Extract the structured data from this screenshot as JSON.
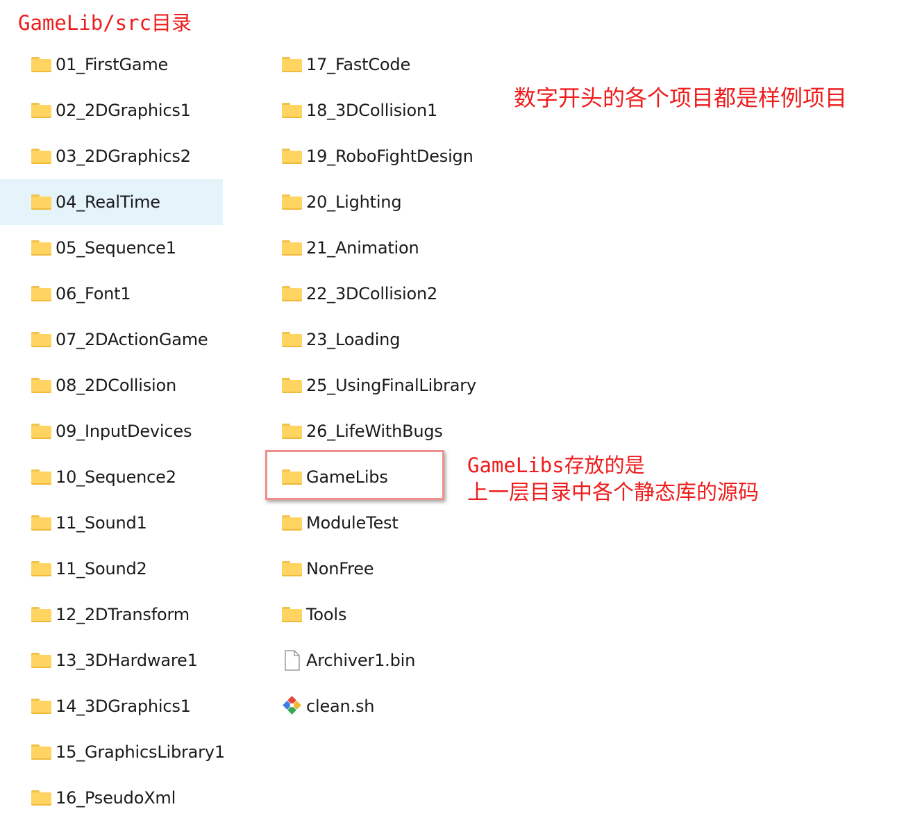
{
  "title": "GameLib/src目录",
  "left_column": [
    {
      "label": "01_FirstGame",
      "type": "folder"
    },
    {
      "label": "02_2DGraphics1",
      "type": "folder"
    },
    {
      "label": "03_2DGraphics2",
      "type": "folder"
    },
    {
      "label": "04_RealTime",
      "type": "folder",
      "selected": true
    },
    {
      "label": "05_Sequence1",
      "type": "folder"
    },
    {
      "label": "06_Font1",
      "type": "folder"
    },
    {
      "label": "07_2DActionGame",
      "type": "folder"
    },
    {
      "label": "08_2DCollision",
      "type": "folder"
    },
    {
      "label": "09_InputDevices",
      "type": "folder"
    },
    {
      "label": "10_Sequence2",
      "type": "folder"
    },
    {
      "label": "11_Sound1",
      "type": "folder"
    },
    {
      "label": "11_Sound2",
      "type": "folder"
    },
    {
      "label": "12_2DTransform",
      "type": "folder"
    },
    {
      "label": "13_3DHardware1",
      "type": "folder"
    },
    {
      "label": "14_3DGraphics1",
      "type": "folder"
    },
    {
      "label": "15_GraphicsLibrary1",
      "type": "folder"
    },
    {
      "label": "16_PseudoXml",
      "type": "folder"
    }
  ],
  "right_column": [
    {
      "label": "17_FastCode",
      "type": "folder"
    },
    {
      "label": "18_3DCollision1",
      "type": "folder"
    },
    {
      "label": "19_RoboFightDesign",
      "type": "folder"
    },
    {
      "label": "20_Lighting",
      "type": "folder"
    },
    {
      "label": "21_Animation",
      "type": "folder"
    },
    {
      "label": "22_3DCollision2",
      "type": "folder"
    },
    {
      "label": "23_Loading",
      "type": "folder"
    },
    {
      "label": "25_UsingFinalLibrary",
      "type": "folder"
    },
    {
      "label": "26_LifeWithBugs",
      "type": "folder"
    },
    {
      "label": "GameLibs",
      "type": "folder",
      "highlighted": true
    },
    {
      "label": "ModuleTest",
      "type": "folder"
    },
    {
      "label": "NonFree",
      "type": "folder"
    },
    {
      "label": "Tools",
      "type": "folder"
    },
    {
      "label": "Archiver1.bin",
      "type": "file"
    },
    {
      "label": "clean.sh",
      "type": "script"
    }
  ],
  "annotations": {
    "samples_note": "数字开头的各个项目都是样例项目",
    "gamelibs_note_line1": "GameLibs存放的是",
    "gamelibs_note_line2": "上一层目录中各个静态库的源码"
  },
  "colors": {
    "annotation": "#ee1c1c",
    "selection": "#e5f3fb",
    "folder": "#ffd460",
    "highlight_box": "#f08d8d"
  }
}
